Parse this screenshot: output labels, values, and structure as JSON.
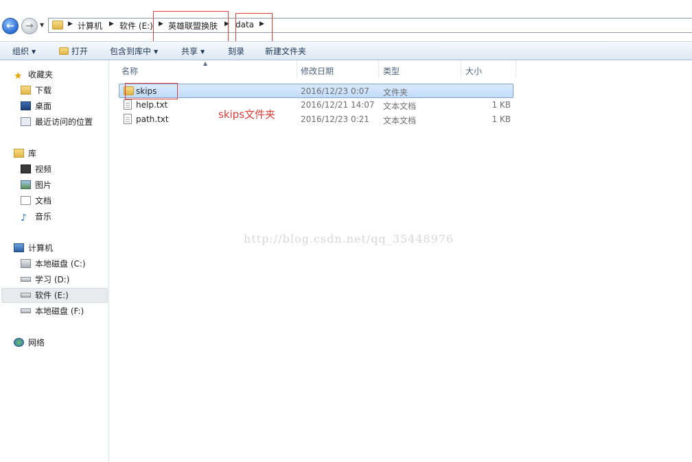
{
  "addressbar": {
    "crumbs": [
      "计算机",
      "软件 (E:)",
      "英雄联盟换肤",
      "data"
    ]
  },
  "toolbar": {
    "organize": "组织",
    "open": "打开",
    "include_in_library": "包含到库中",
    "share": "共享",
    "burn": "刻录",
    "new_folder": "新建文件夹"
  },
  "navpane": {
    "favorites": {
      "label": "收藏夹",
      "items": [
        "下载",
        "桌面",
        "最近访问的位置"
      ]
    },
    "libraries": {
      "label": "库",
      "items": [
        "视频",
        "图片",
        "文档",
        "音乐"
      ]
    },
    "computer": {
      "label": "计算机",
      "items": [
        "本地磁盘 (C:)",
        "学习 (D:)",
        "软件 (E:)",
        "本地磁盘 (F:)"
      ]
    },
    "network": {
      "label": "网络"
    },
    "selected": "软件 (E:)"
  },
  "columns": {
    "name": "名称",
    "modified": "修改日期",
    "type": "类型",
    "size": "大小"
  },
  "files": [
    {
      "name": "skips",
      "modified": "2016/12/23 0:07",
      "type": "文件夹",
      "size": "",
      "icon": "folder-icon"
    },
    {
      "name": "help.txt",
      "modified": "2016/12/21 14:07",
      "type": "文本文档",
      "size": "1 KB",
      "icon": "text-file-icon"
    },
    {
      "name": "path.txt",
      "modified": "2016/12/23 0:21",
      "type": "文本文档",
      "size": "1 KB",
      "icon": "text-file-icon"
    }
  ],
  "annotation": "skips文件夹",
  "watermark": "http://blog.csdn.net/qq_35448976",
  "colors": {
    "annotation_red": "#e23b3b",
    "selection_blue": "#c1dcfc"
  }
}
